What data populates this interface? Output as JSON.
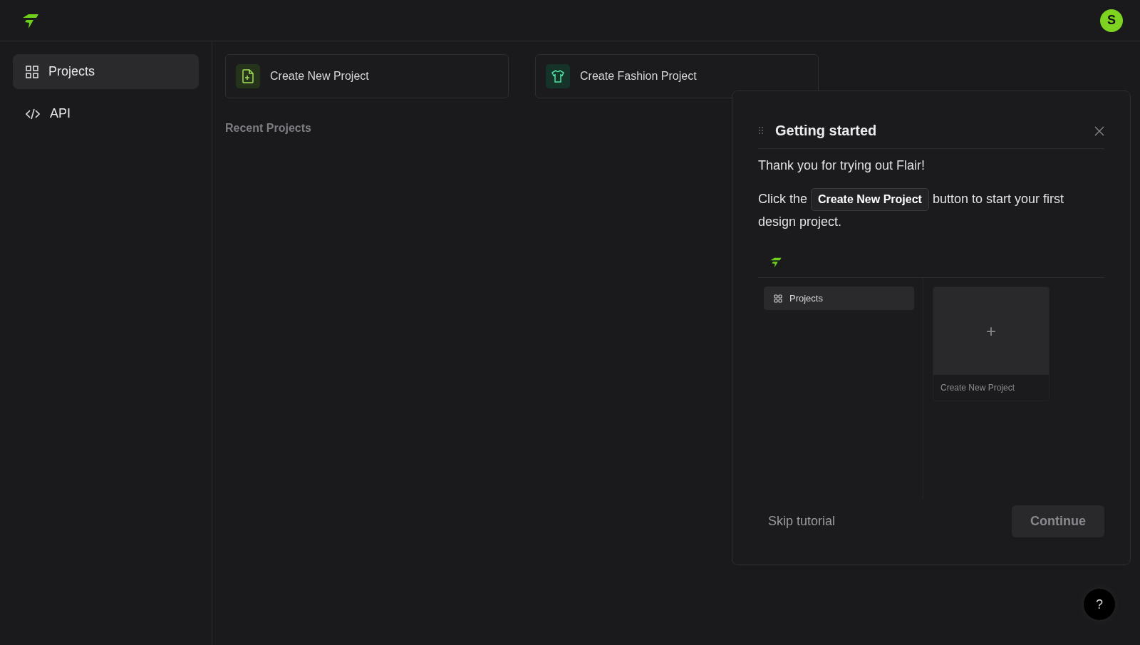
{
  "header": {
    "avatar_initial": "S"
  },
  "sidebar": {
    "items": [
      {
        "label": "Projects",
        "kind": "grid",
        "selected": true
      },
      {
        "label": "API",
        "kind": "code",
        "selected": false
      }
    ]
  },
  "actions": [
    {
      "label": "Create New Project",
      "kind": "document"
    },
    {
      "label": "Create Fashion Project",
      "kind": "fashion"
    }
  ],
  "recent_projects": {
    "title": "Recent Projects"
  },
  "tutorial": {
    "title": "Getting started",
    "intro": "Thank you for trying out Flair!",
    "instruction": {
      "before": "Click the",
      "chip": "Create New Project",
      "after": "button to start your first design project."
    },
    "preview": {
      "sidebar_item": "Projects",
      "card_label": "Create New Project",
      "card_symbol": "+"
    },
    "skip": "Skip tutorial",
    "continue": {
      "label": "Continue",
      "disabled": true
    }
  },
  "help_button": {
    "label": "?"
  }
}
